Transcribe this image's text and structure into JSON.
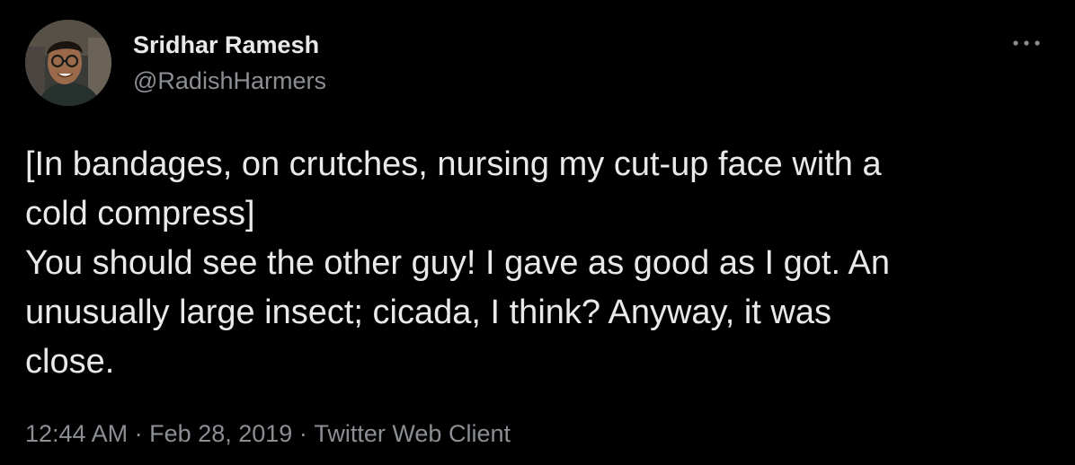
{
  "author": {
    "display_name": "Sridhar Ramesh",
    "handle": "@RadishHarmers",
    "avatar_icon": "profile-photo"
  },
  "tweet": {
    "text_lines": [
      "[In bandages, on crutches, nursing my cut-up face with a",
      "cold compress]",
      "You should see the other guy! I gave as good as I got. An",
      "unusually large insect; cicada, I think? Anyway, it was",
      "close."
    ]
  },
  "meta": {
    "time": "12:44 AM",
    "separator": "·",
    "date": "Feb 28, 2019",
    "source": "Twitter Web Client"
  },
  "more_icon": "more-horizontal-icon",
  "colors": {
    "background": "#000000",
    "primary_text": "#e7e9ea",
    "secondary_text": "#8b8f94"
  }
}
